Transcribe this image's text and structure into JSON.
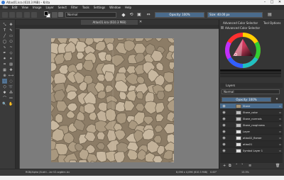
{
  "window": {
    "title": "Atlas01.kra (610.3 MiB) – Krita",
    "controls": [
      "–",
      "□",
      "✕"
    ]
  },
  "menu": [
    "File",
    "Edit",
    "View",
    "Image",
    "Layer",
    "Select",
    "Filter",
    "Tools",
    "Settings",
    "Window",
    "Help"
  ],
  "toolbar": {
    "blend_mode": "Normal",
    "opacity": "Opacity: 100%",
    "size": "Size: 40.00 px"
  },
  "document_tab": "Atlas01.kra (610.3 MiB)",
  "docker": {
    "color_tabs": [
      "Advanced Color Selector",
      "Tool Options"
    ],
    "color_title": "Advanced Color Selector",
    "layers_title": "Layers",
    "layers_blend": "Normal",
    "layers_opacity": "Opacity: 100%",
    "layers": [
      {
        "name": "Stone",
        "selected": true
      },
      {
        "name": "Stone_color",
        "selected": false
      },
      {
        "name": "Stone_normals",
        "selected": false
      },
      {
        "name": "Stone_roughness",
        "selected": false
      },
      {
        "name": "Layer",
        "selected": false
      },
      {
        "name": "atlas02_flamer",
        "selected": false
      },
      {
        "name": "atlas01",
        "selected": false
      },
      {
        "name": "Symbol Layer 1",
        "selected": false
      }
    ]
  },
  "status": {
    "color_space": "RGB/Alpha (8-bit i...lar V2-srgbtrc.icc",
    "dimensions": "8,096 x 4,096 (610.3 MiB)",
    "rotation": "0.00°",
    "zoom": "13.3%"
  },
  "colors": {
    "accent": "#4a6b8c",
    "panel": "#353535",
    "canvas": "#7c7c7c",
    "texture": "#b3a189"
  },
  "icons": {
    "tools": [
      "transform",
      "move",
      "text",
      "brush",
      "line",
      "rect",
      "ellipse",
      "polygon",
      "path",
      "freehand-path",
      "calligraphy",
      "shape-edit",
      "dynamic-brush",
      "multibrush",
      "crop",
      "fill",
      "gradient",
      "color-picker",
      "assistant",
      "measure",
      "rect-select",
      "ellipse-select",
      "polygon-select",
      "freehand-select",
      "contiguous-select",
      "similar-select",
      "bezier-select",
      "magnetic-select",
      "zoom",
      "pan"
    ]
  }
}
